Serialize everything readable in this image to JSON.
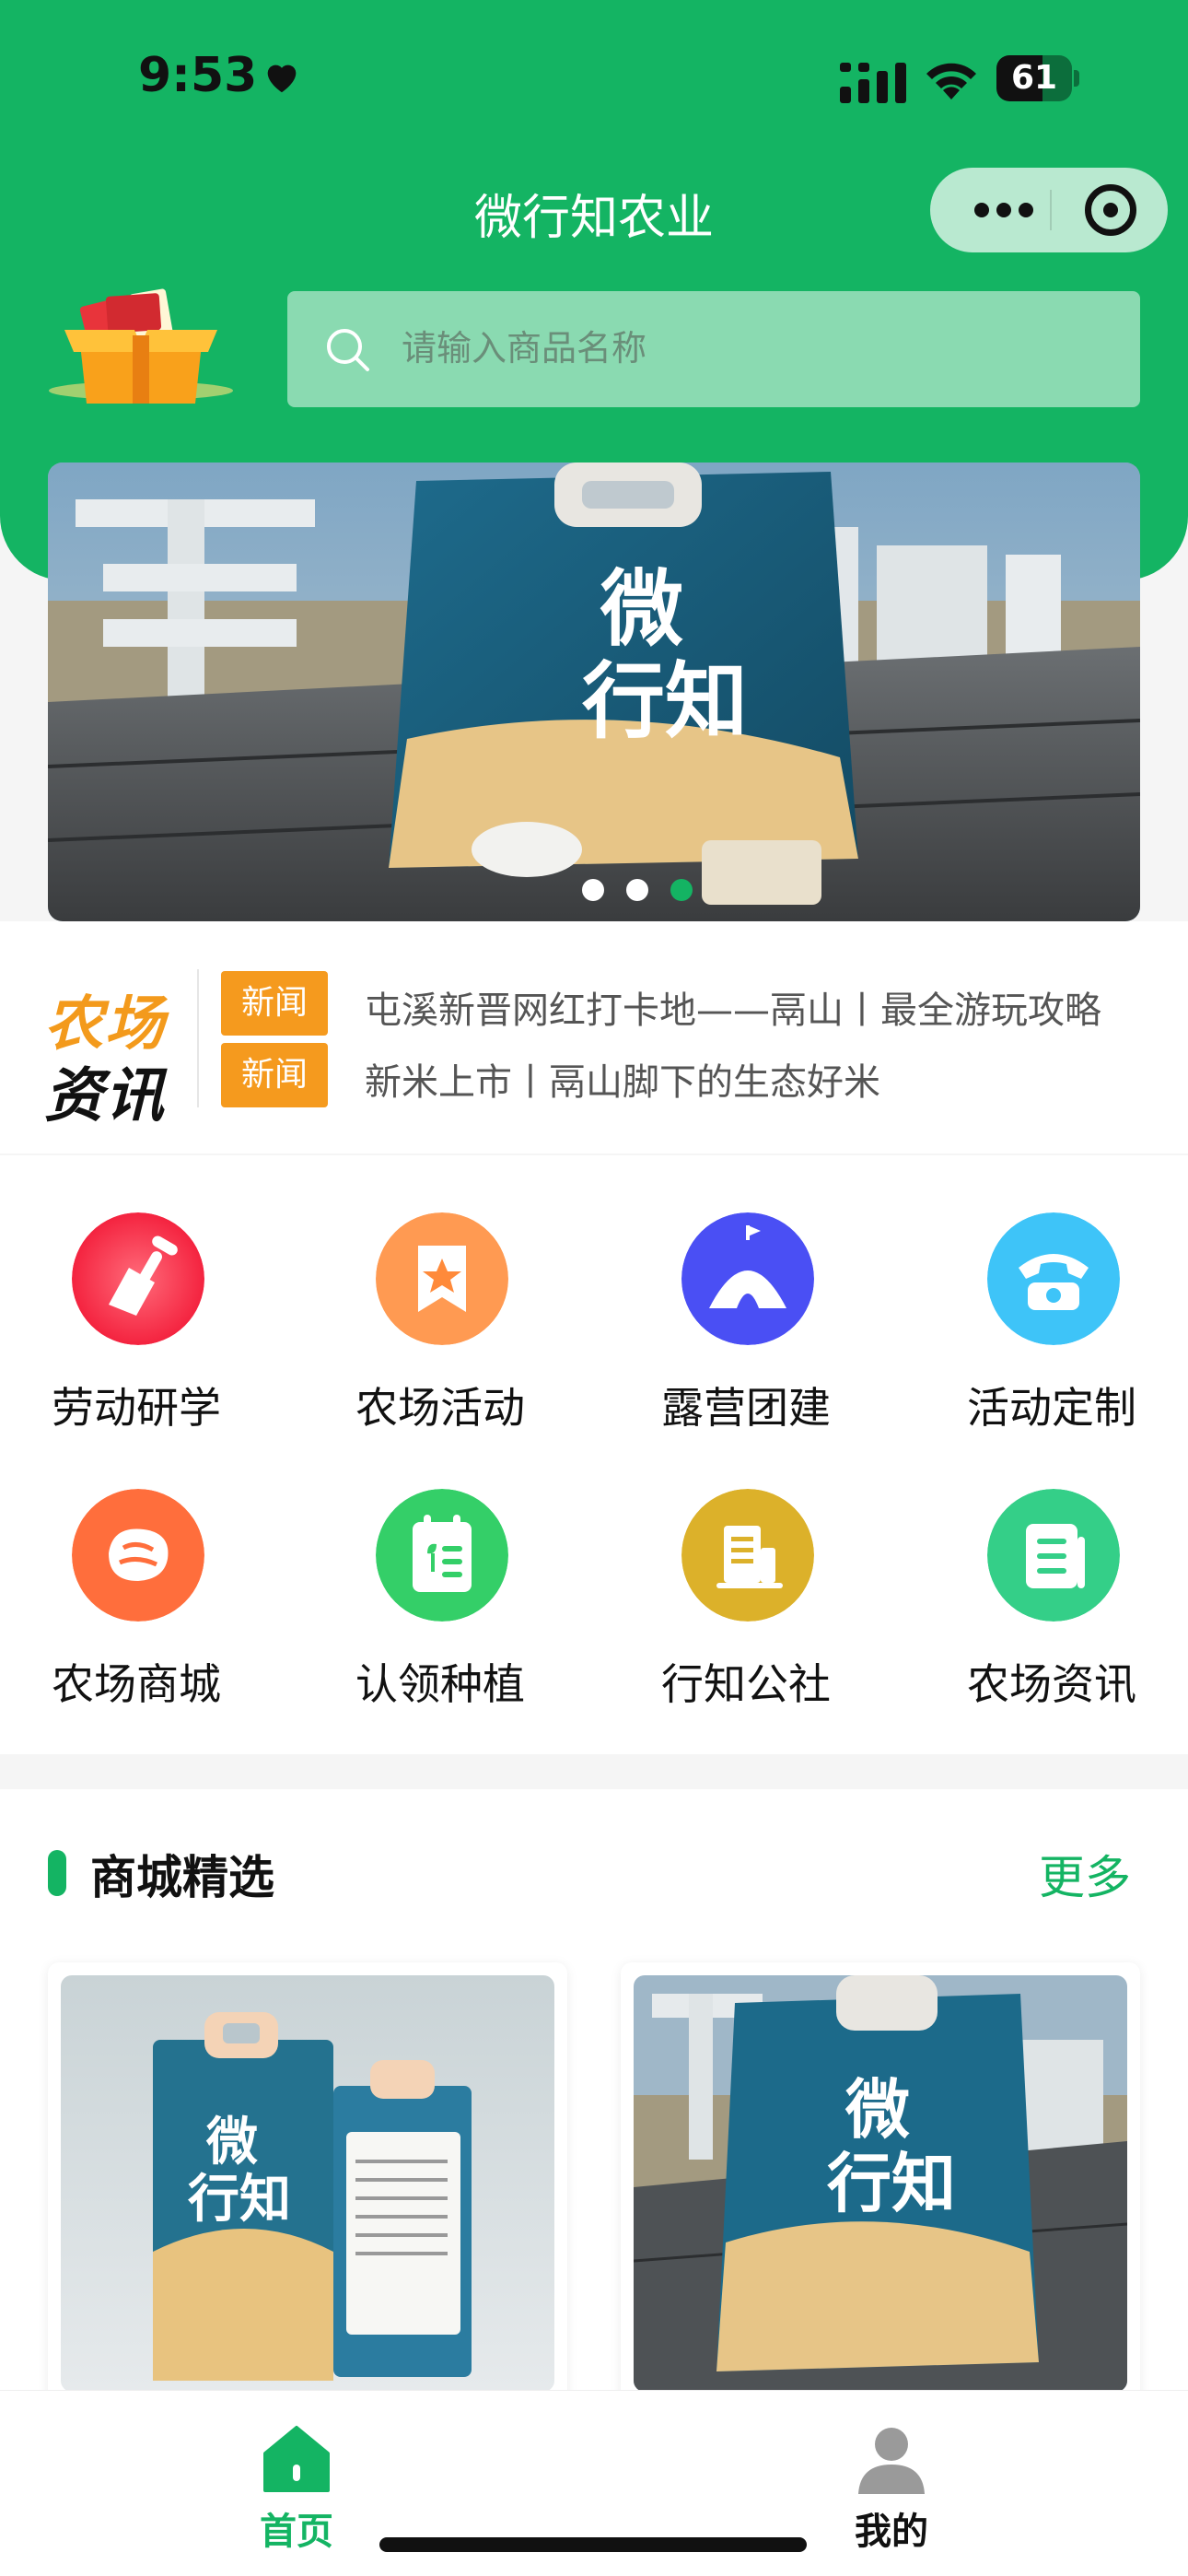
{
  "status_bar": {
    "time": "9:53",
    "battery": "61",
    "battery_level": 0.61
  },
  "title_bar": {
    "title": "微行知农业",
    "more_icon": "more-dots-icon",
    "close_icon": "target-icon"
  },
  "search": {
    "placeholder": "请输入商品名称",
    "icon": "search-icon"
  },
  "banner": {
    "slide_count": 3,
    "active_index": 2
  },
  "news": {
    "logo_line1": "农场",
    "logo_line2": "资讯",
    "items": [
      {
        "tag": "新闻",
        "text": "屯溪新晋网红打卡地——鬲山丨最全游玩攻略"
      },
      {
        "tag": "新闻",
        "text": "新米上市丨鬲山脚下的生态好米"
      }
    ]
  },
  "menu": {
    "items": [
      {
        "label": "劳动研学",
        "icon": "shovel-icon",
        "color_from": "#ff6b7a",
        "color_to": "#f4233f"
      },
      {
        "label": "农场活动",
        "icon": "star-bookmark-icon",
        "color_from": "#ffb27a",
        "color_to": "#ff8a3a"
      },
      {
        "label": "露营团建",
        "icon": "tent-icon",
        "color_from": "#6f7dff",
        "color_to": "#3a3ff0"
      },
      {
        "label": "活动定制",
        "icon": "telephone-icon",
        "color_from": "#67d8ff",
        "color_to": "#1fb0f2"
      },
      {
        "label": "农场商城",
        "icon": "bread-icon",
        "color_from": "#ff8a5a",
        "color_to": "#ff5a28"
      },
      {
        "label": "认领种植",
        "icon": "plant-list-icon",
        "color_from": "#6ee88a",
        "color_to": "#20c255"
      },
      {
        "label": "行知公社",
        "icon": "building-icon",
        "color_from": "#f5d66a",
        "color_to": "#c89b12"
      },
      {
        "label": "农场资讯",
        "icon": "document-icon",
        "color_from": "#6ee8a8",
        "color_to": "#20c27a"
      }
    ]
  },
  "mall": {
    "title": "商城精选",
    "more": "更多"
  },
  "tabbar": {
    "items": [
      {
        "label": "首页",
        "icon": "home-icon",
        "active": true
      },
      {
        "label": "我的",
        "icon": "user-icon",
        "active": false
      }
    ]
  },
  "colors": {
    "primary": "#14b463",
    "tag_orange": "#f59a1e"
  }
}
